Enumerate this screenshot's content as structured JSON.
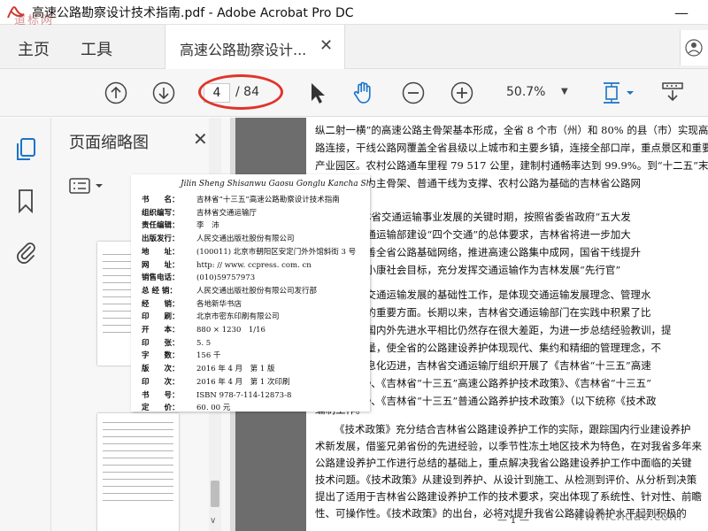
{
  "window": {
    "title": "高速公路勘察设计技术指南.pdf - Adobe Acrobat Pro DC",
    "minimize_glyph": "—",
    "watermark_top": "道标网"
  },
  "tabs": {
    "home": "主页",
    "tools": "工具",
    "document": "高速公路勘察设计...",
    "close_glyph": "✕"
  },
  "toolbar": {
    "icons": [
      "prev-page-icon",
      "next-page-icon",
      "select-cursor-icon",
      "hand-tool-icon",
      "zoom-out-icon",
      "zoom-in-icon",
      "page-fit-icon",
      "scroll-tool-icon"
    ],
    "current_page": "4",
    "total_pages": "/ 84",
    "zoom": "50.7%",
    "dropdown_glyph": "▼",
    "annotation_color": "#e0342a"
  },
  "sidebar": {
    "icons": [
      "page-thumbnails-icon",
      "bookmark-icon",
      "attachment-icon"
    ],
    "accent": "#1a73c8"
  },
  "thumbnails": {
    "title": "页面缩略图",
    "close_glyph": "✕",
    "scroll_down_glyph": "∨"
  },
  "copyright_page": {
    "pinyin": "Jilin Sheng Shisanwu Gaosu Gonglu Kancha Sheji Jishu Zhinan",
    "rows": [
      {
        "k": "书　　名：",
        "v": "吉林省“十三五”高速公路勘察设计技术指南"
      },
      {
        "k": "组织编写：",
        "v": "吉林省交通运输厅"
      },
      {
        "k": "责任编辑：",
        "v": "李　沛"
      },
      {
        "k": "出版发行：",
        "v": "人民交通出版社股份有限公司"
      },
      {
        "k": "地　　址：",
        "v": "(100011) 北京市朝阳区安定门外外馆斜街 3 号"
      },
      {
        "k": "网　　址：",
        "v": "http: // www. ccpress. com. cn"
      },
      {
        "k": "销售电话：",
        "v": "(010)59757973"
      },
      {
        "k": "总 经 销：",
        "v": "人民交通出版社股份有限公司发行部"
      },
      {
        "k": "经　　销：",
        "v": "各地新华书店"
      },
      {
        "k": "印　　刷：",
        "v": "北京市密东印刷有限公司"
      },
      {
        "k": "开　　本：",
        "v": "880 × 1230　1/16"
      },
      {
        "k": "印　　张：",
        "v": "5. 5"
      },
      {
        "k": "字　　数：",
        "v": "156 千"
      },
      {
        "k": "版　　次：",
        "v": "2016 年 4 月　第 1 版"
      },
      {
        "k": "印　　次：",
        "v": "2016 年 4 月　第 1 次印刷"
      },
      {
        "k": "书　　号：",
        "v": "ISBN 978-7-114-12873-8"
      },
      {
        "k": "定　　价：",
        "v": "60. 00 元"
      }
    ]
  },
  "document": {
    "lines": [
      "纵二射一横”的高速公路主骨架基本形成，全省 8 个市（州）和 80% 的县（市）实现高速",
      "路连接，干线公路网覆盖全省县级以上城市和主要乡镇，连接全部口岸，重点景区和重要",
      "产业园区。农村公路通车里程 79 517 公里，建制村通畅率达到 99.9%。到“十二五”末",
      "以高速公路为主骨架、普通干线为支撑、农村公路为基础的吉林省公路网",
      "”期，是吉林省交通运输事业发展的关键时期，按照省委省政府“五大发",
      "略部署和交通运输部建设“四个交通”的总体要求，吉林省将进一步加大",
      "度，加快完善全省公路基础网络，推进高速公路集中成网，国省干线提升",
      "路全面实现小康社会目标，充分发挥交通运输作为吉林发展“先行官”",
      "设和养护是交通运输发展的基础性工作，是体现交通运输发展理念、管理水",
      "、服务能力的重要方面。长期以来，吉林省交通运输部门在实践中积累了比",
      "验，但是与国内外先进水平相比仍然存在很大差距，为进一步总结经验教训，提",
      "提升工程质量，使全省的公路建设养护体现现代、集约和精细的管理理念，不",
      "标准化、信息化迈进，吉林省交通运输厅组织开展了《吉林省“十三五”高速",
      "计技术指南》、《吉林省“十三五”高速公路养护技术政策》、《吉林省“十三五”",
      "设技术政策》、《吉林省“十三五”普通公路养护技术政策》（以下统称《技术政",
      "编制工作。",
      "《技术政策》充分结合吉林省公路建设养护工作的实际，跟踪国内行业建设养护",
      "术新发展，借鉴兄弟省份的先进经验，以季节性冻土地区技术为特色，在对我省多年来",
      "公路建设养护工作进行总结的基础上，重点解决我省公路建设养护工作中面临的关键",
      "技术问题。《技术政策》从建设到养护、从设计到施工、从检测到评价、从分析到决策",
      "提出了适用于吉林省公路建设养护工作的技术要求，突出体现了系统性、针对性、前瞻",
      "性、可操作性。《技术政策》的出台，必将对提升我省公路建设养护水平起到积极的"
    ],
    "page_number": "— 1 —",
    "watermark_bottom": "www.chdao.com"
  }
}
